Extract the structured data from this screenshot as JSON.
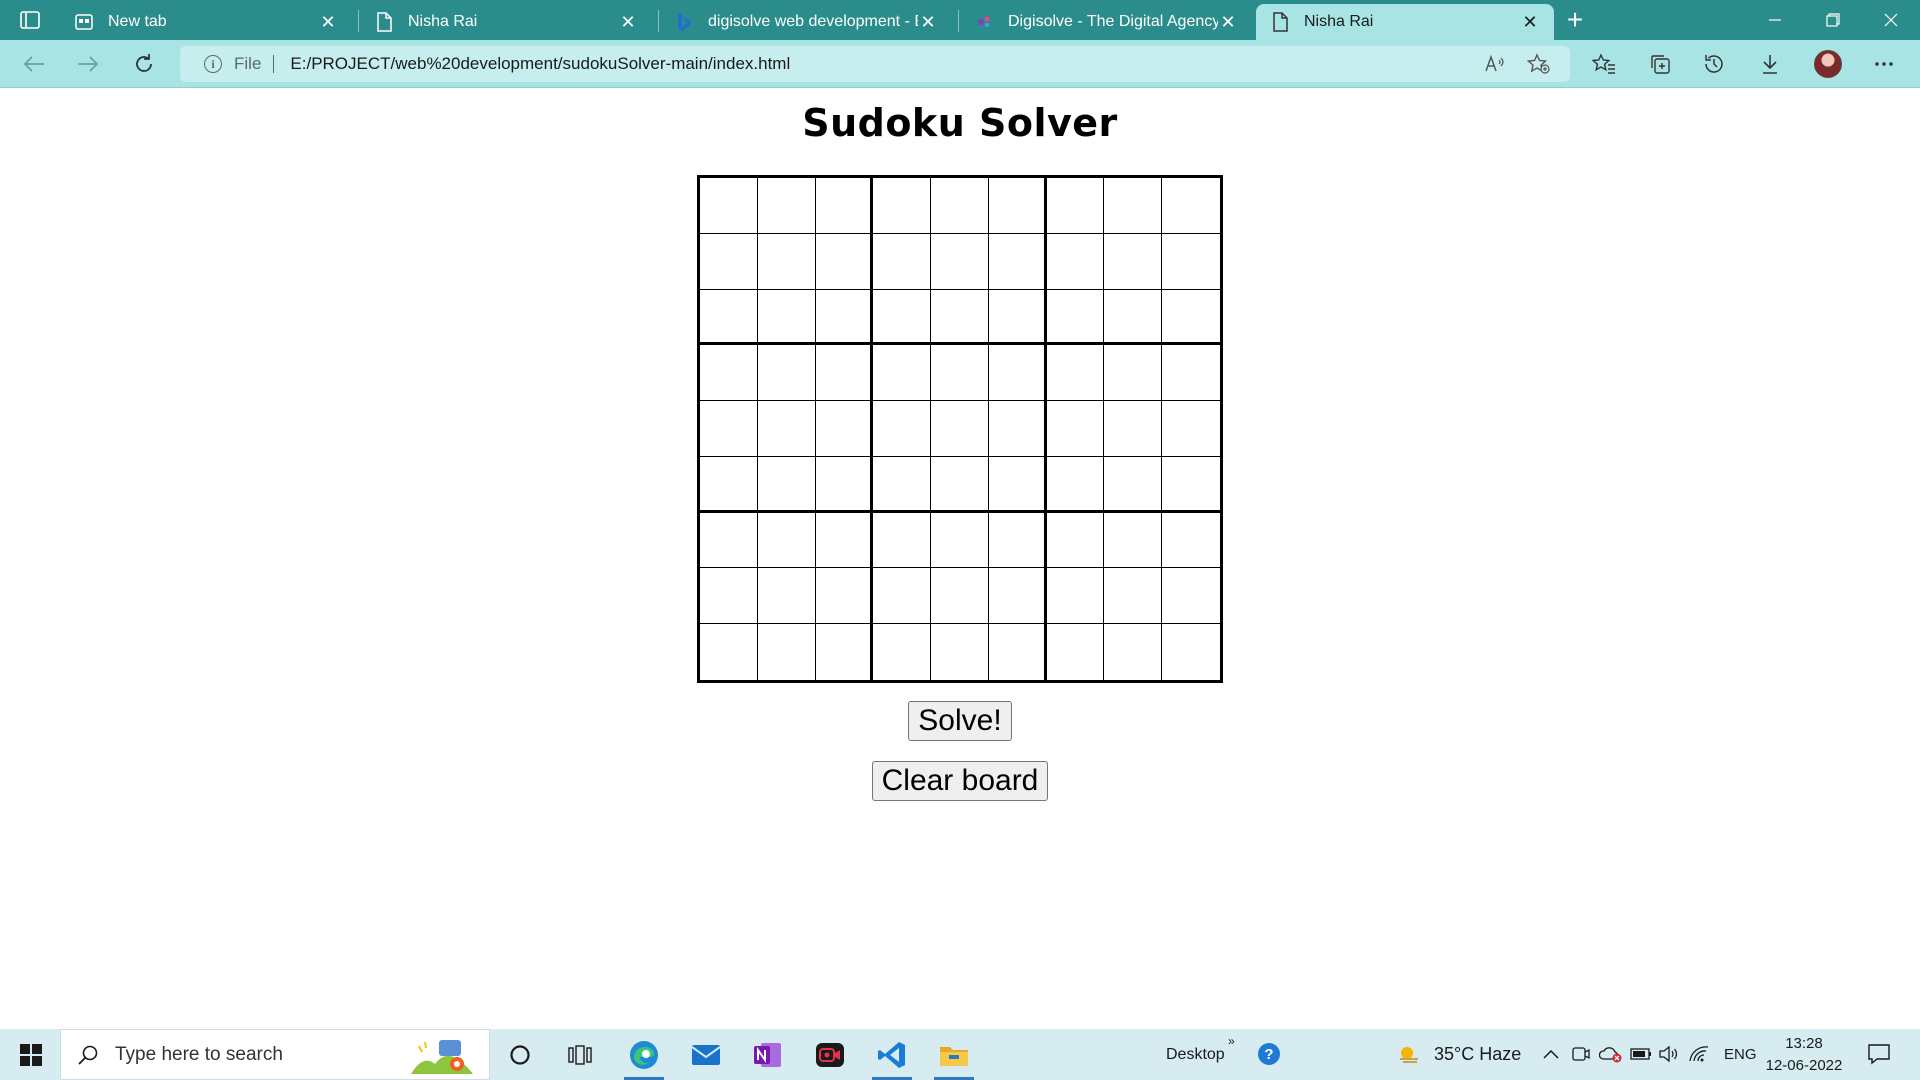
{
  "browser": {
    "tabs": [
      {
        "title": "New tab",
        "icon": "newtab-icon"
      },
      {
        "title": "Nisha Rai",
        "icon": "file-icon"
      },
      {
        "title": "digisolve web development - Bin",
        "icon": "bing-icon"
      },
      {
        "title": "Digisolve - The Digital Agency fo",
        "icon": "site-icon"
      },
      {
        "title": "Nisha Rai",
        "icon": "file-icon",
        "active": true
      }
    ],
    "address": {
      "scheme_label": "File",
      "url": "E:/PROJECT/web%20development/sudokuSolver-main/index.html"
    }
  },
  "page": {
    "title": "Sudoku Solver",
    "solve_label": "Solve!",
    "clear_label": "Clear board",
    "grid_rows": 9,
    "grid_cols": 9
  },
  "taskbar": {
    "search_placeholder": "Type here to search",
    "desktop_label": "Desktop",
    "weather": "35°C  Haze",
    "language": "ENG",
    "time": "13:28",
    "date": "12-06-2022"
  },
  "colors": {
    "tab_strip": "#2b8c8c",
    "toolbar": "#a8e4e4",
    "taskbar": "#d6ecf1"
  }
}
